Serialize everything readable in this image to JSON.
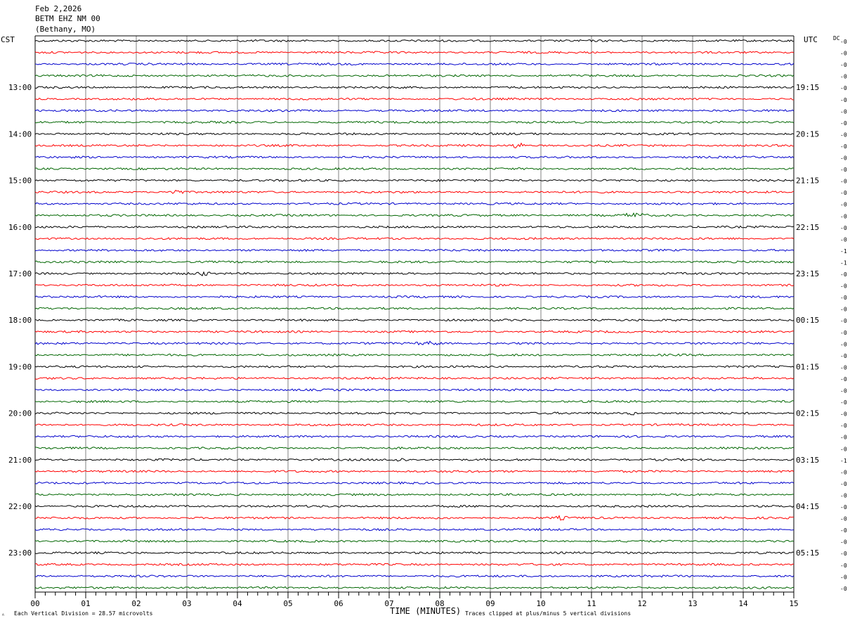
{
  "header": {
    "date": "Feb 2,2026",
    "station": "BETM EHZ NM 00",
    "location": "(Bethany, MO)"
  },
  "axes": {
    "left_zone": "CST",
    "right_zone": "UTC",
    "dc_label": "DC",
    "xlabel": "TIME (MINUTES)"
  },
  "footer": {
    "scale_note": "Each Vertical Division =   28.57 microvolts",
    "clip_note": "Traces clipped at plus/minus 5 vertical divisions",
    "corner_mark": "ᴬ"
  },
  "colors": {
    "trace_cycle": [
      "#000000",
      "#ff0000",
      "#0000cc",
      "#006600"
    ],
    "grid": "#808080",
    "frame": "#000000"
  },
  "chart_data": {
    "type": "line",
    "description_kind": "helicorder",
    "x_ticks": [
      "00",
      "01",
      "02",
      "03",
      "04",
      "05",
      "06",
      "07",
      "08",
      "09",
      "10",
      "11",
      "12",
      "13",
      "14",
      "15"
    ],
    "xlim": [
      0,
      15
    ],
    "trace_minutes": 15,
    "trace_count": 48,
    "left_hour_labels": [
      {
        "trace": 4,
        "text": "13:00"
      },
      {
        "trace": 8,
        "text": "14:00"
      },
      {
        "trace": 12,
        "text": "15:00"
      },
      {
        "trace": 16,
        "text": "16:00"
      },
      {
        "trace": 20,
        "text": "17:00"
      },
      {
        "trace": 24,
        "text": "18:00"
      },
      {
        "trace": 28,
        "text": "19:00"
      },
      {
        "trace": 32,
        "text": "20:00"
      },
      {
        "trace": 36,
        "text": "21:00"
      },
      {
        "trace": 40,
        "text": "22:00"
      },
      {
        "trace": 44,
        "text": "23:00"
      }
    ],
    "right_hour_labels": [
      {
        "trace": 4,
        "text": "19:15"
      },
      {
        "trace": 8,
        "text": "20:15"
      },
      {
        "trace": 12,
        "text": "21:15"
      },
      {
        "trace": 16,
        "text": "22:15"
      },
      {
        "trace": 20,
        "text": "23:15"
      },
      {
        "trace": 24,
        "text": "00:15"
      },
      {
        "trace": 28,
        "text": "01:15"
      },
      {
        "trace": 32,
        "text": "02:15"
      },
      {
        "trace": 36,
        "text": "03:15"
      },
      {
        "trace": 40,
        "text": "04:15"
      },
      {
        "trace": 44,
        "text": "05:15"
      }
    ],
    "dc_offsets": [
      "-0",
      "-0",
      "-0",
      "-0",
      "-0",
      "-0",
      "-0",
      "-0",
      "-0",
      "-0",
      "-0",
      "-0",
      "-0",
      "-0",
      "-0",
      "-0",
      "-0",
      "-0",
      "-1",
      "-1",
      "-0",
      "-0",
      "-0",
      "-0",
      "-0",
      "-0",
      "-0",
      "-0",
      "-0",
      "-0",
      "-0",
      "-0",
      "-0",
      "-0",
      "-0",
      "-0",
      "-1",
      "-0",
      "-0",
      "-0",
      "-0",
      "-0",
      "-0",
      "-0",
      "-0",
      "-0",
      "-0",
      "-0"
    ],
    "events": [
      {
        "trace": 3,
        "minute": 5.52,
        "amplitude": 8,
        "width": 0.05
      },
      {
        "trace": 9,
        "minute": 9.55,
        "amplitude": 5,
        "width": 0.15
      },
      {
        "trace": 13,
        "minute": 2.75,
        "amplitude": 3,
        "width": 0.25
      },
      {
        "trace": 15,
        "minute": 11.85,
        "amplitude": 3,
        "width": 0.3
      },
      {
        "trace": 20,
        "minute": 3.3,
        "amplitude": 2.5,
        "width": 0.2
      },
      {
        "trace": 26,
        "minute": 7.8,
        "amplitude": 2,
        "width": 0.4
      },
      {
        "trace": 32,
        "minute": 11.8,
        "amplitude": 2,
        "width": 0.15
      },
      {
        "trace": 36,
        "minute": 7.2,
        "amplitude": 2,
        "width": 0.25
      },
      {
        "trace": 41,
        "minute": 10.4,
        "amplitude": 2,
        "width": 0.2
      }
    ]
  }
}
